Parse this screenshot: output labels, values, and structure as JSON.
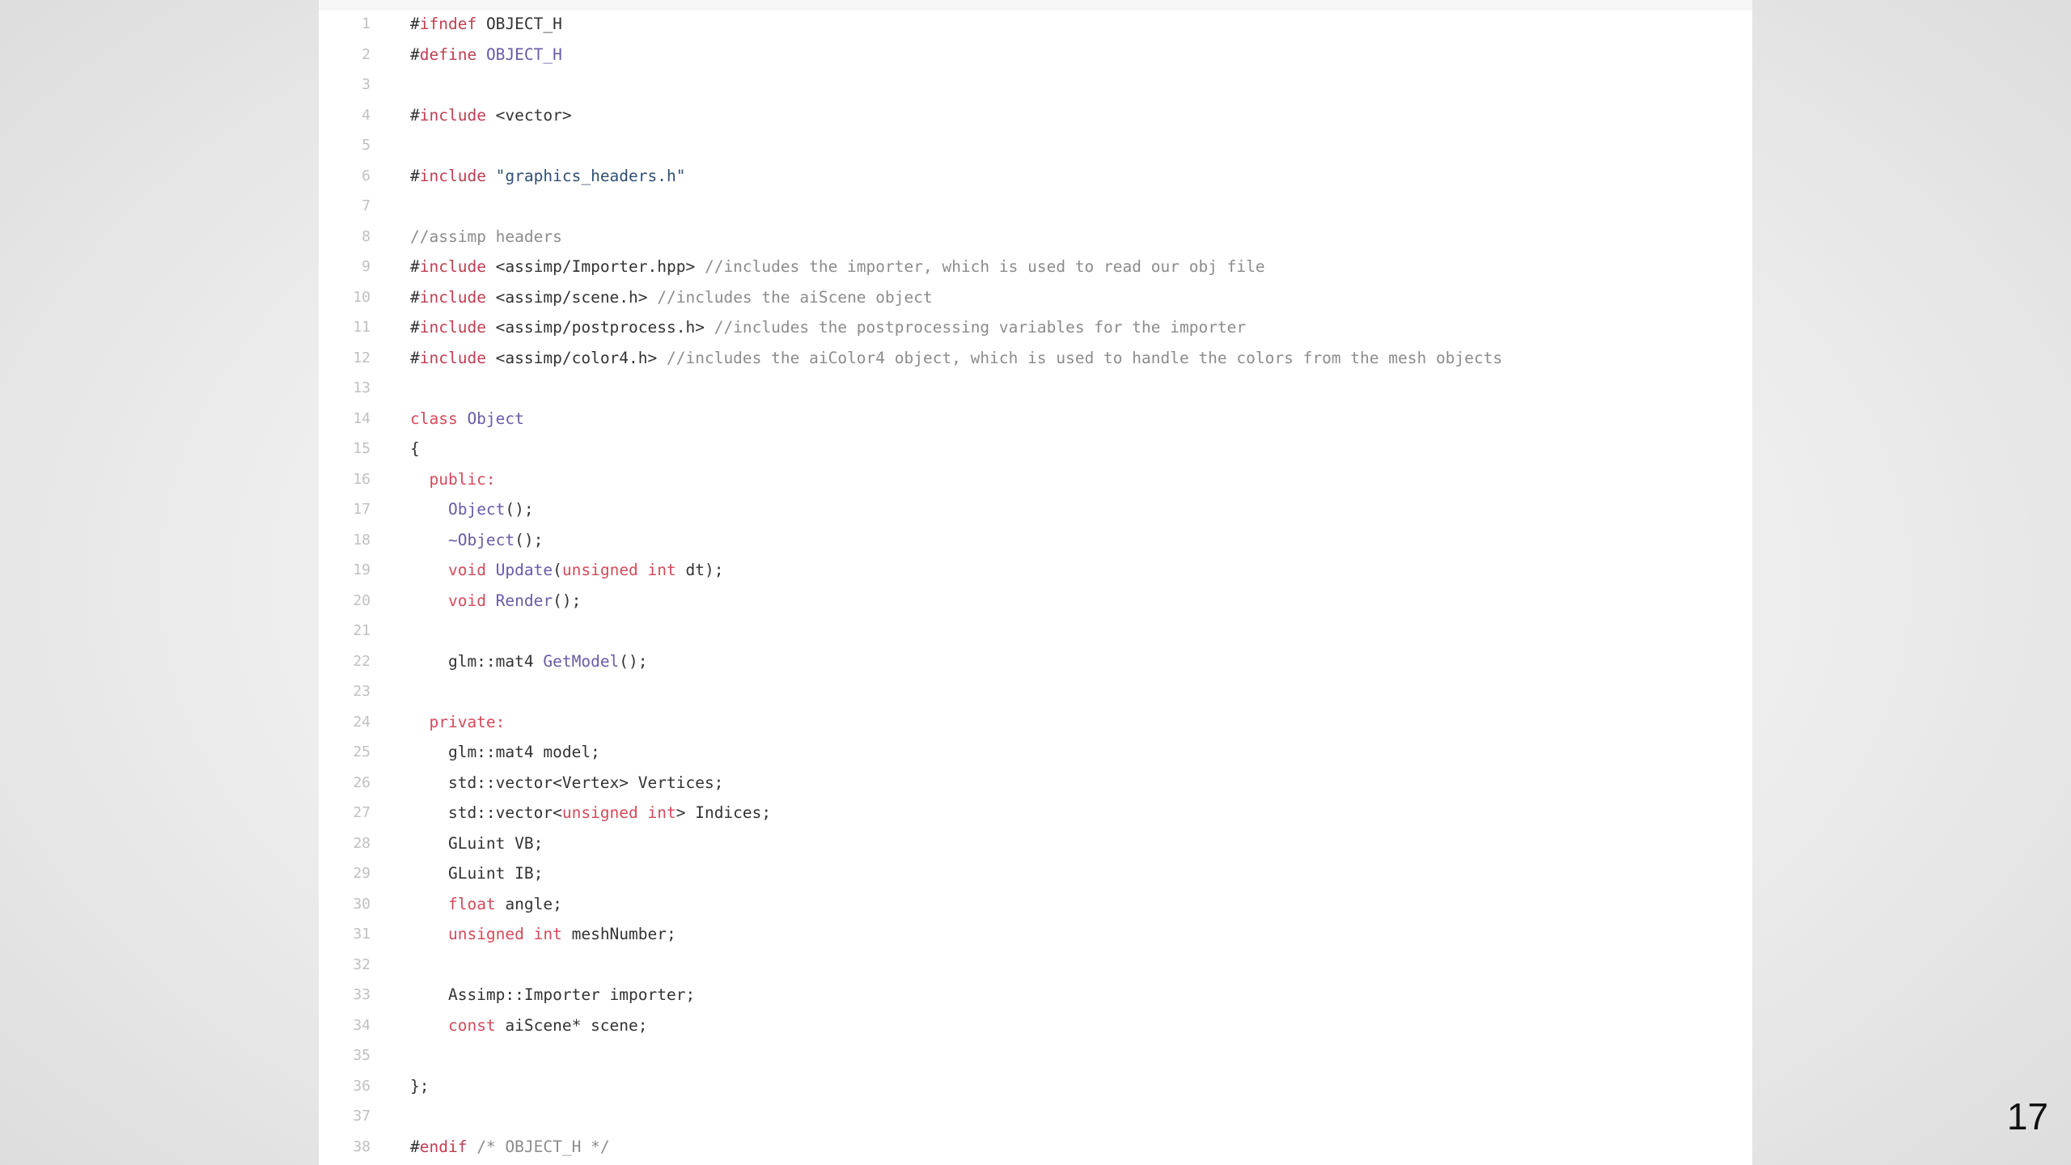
{
  "slide": {
    "number": "17"
  },
  "colors": {
    "keyword": "#d44a5a",
    "preprocessor": "#bf3f52",
    "name": "#6b5aa8",
    "string": "#2f4f74",
    "comment": "#8c8c8c",
    "plain": "#333333",
    "line_number": "#c0c0c0"
  },
  "code": {
    "lines": [
      {
        "num": "1",
        "tokens": [
          [
            "plain",
            "#"
          ],
          [
            "pre",
            "ifndef"
          ],
          [
            "plain",
            " OBJECT_H"
          ]
        ]
      },
      {
        "num": "2",
        "tokens": [
          [
            "plain",
            "#"
          ],
          [
            "pre",
            "define"
          ],
          [
            "name",
            " OBJECT_H"
          ]
        ]
      },
      {
        "num": "3",
        "tokens": []
      },
      {
        "num": "4",
        "tokens": [
          [
            "plain",
            "#"
          ],
          [
            "pre",
            "include"
          ],
          [
            "plain",
            " <vector>"
          ]
        ]
      },
      {
        "num": "5",
        "tokens": []
      },
      {
        "num": "6",
        "tokens": [
          [
            "plain",
            "#"
          ],
          [
            "pre",
            "include"
          ],
          [
            "str",
            " \"graphics_headers.h\""
          ]
        ]
      },
      {
        "num": "7",
        "tokens": []
      },
      {
        "num": "8",
        "tokens": [
          [
            "com",
            "//assimp headers"
          ]
        ]
      },
      {
        "num": "9",
        "tokens": [
          [
            "plain",
            "#"
          ],
          [
            "pre",
            "include"
          ],
          [
            "plain",
            " <assimp/Importer.hpp>"
          ],
          [
            "com",
            " //includes the importer, which is used to read our obj file"
          ]
        ]
      },
      {
        "num": "10",
        "tokens": [
          [
            "plain",
            "#"
          ],
          [
            "pre",
            "include"
          ],
          [
            "plain",
            " <assimp/scene.h>"
          ],
          [
            "com",
            " //includes the aiScene object"
          ]
        ]
      },
      {
        "num": "11",
        "tokens": [
          [
            "plain",
            "#"
          ],
          [
            "pre",
            "include"
          ],
          [
            "plain",
            " <assimp/postprocess.h>"
          ],
          [
            "com",
            " //includes the postprocessing variables for the importer"
          ]
        ]
      },
      {
        "num": "12",
        "tokens": [
          [
            "plain",
            "#"
          ],
          [
            "pre",
            "include"
          ],
          [
            "plain",
            " <assimp/color4.h>"
          ],
          [
            "com",
            " //includes the aiColor4 object, which is used to handle the colors from the mesh objects"
          ]
        ]
      },
      {
        "num": "13",
        "tokens": []
      },
      {
        "num": "14",
        "tokens": [
          [
            "kw",
            "class"
          ],
          [
            "name",
            " Object"
          ]
        ]
      },
      {
        "num": "15",
        "tokens": [
          [
            "plain",
            "{"
          ]
        ]
      },
      {
        "num": "16",
        "tokens": [
          [
            "plain",
            "  "
          ],
          [
            "kw",
            "public:"
          ]
        ]
      },
      {
        "num": "17",
        "tokens": [
          [
            "plain",
            "    "
          ],
          [
            "name",
            "Object"
          ],
          [
            "plain",
            "();"
          ]
        ]
      },
      {
        "num": "18",
        "tokens": [
          [
            "plain",
            "    "
          ],
          [
            "name",
            "~Object"
          ],
          [
            "plain",
            "();"
          ]
        ]
      },
      {
        "num": "19",
        "tokens": [
          [
            "plain",
            "    "
          ],
          [
            "kw",
            "void"
          ],
          [
            "name",
            " Update"
          ],
          [
            "plain",
            "("
          ],
          [
            "kw",
            "unsigned int"
          ],
          [
            "plain",
            " dt);"
          ]
        ]
      },
      {
        "num": "20",
        "tokens": [
          [
            "plain",
            "    "
          ],
          [
            "kw",
            "void"
          ],
          [
            "name",
            " Render"
          ],
          [
            "plain",
            "();"
          ]
        ]
      },
      {
        "num": "21",
        "tokens": []
      },
      {
        "num": "22",
        "tokens": [
          [
            "plain",
            "    glm::mat4 "
          ],
          [
            "name",
            "GetModel"
          ],
          [
            "plain",
            "();"
          ]
        ]
      },
      {
        "num": "23",
        "tokens": []
      },
      {
        "num": "24",
        "tokens": [
          [
            "plain",
            "  "
          ],
          [
            "kw",
            "private:"
          ]
        ]
      },
      {
        "num": "25",
        "tokens": [
          [
            "plain",
            "    glm::mat4 model;"
          ]
        ]
      },
      {
        "num": "26",
        "tokens": [
          [
            "plain",
            "    std::vector<Vertex> Vertices;"
          ]
        ]
      },
      {
        "num": "27",
        "tokens": [
          [
            "plain",
            "    std::vector<"
          ],
          [
            "kw",
            "unsigned int"
          ],
          [
            "plain",
            "> Indices;"
          ]
        ]
      },
      {
        "num": "28",
        "tokens": [
          [
            "plain",
            "    GLuint VB;"
          ]
        ]
      },
      {
        "num": "29",
        "tokens": [
          [
            "plain",
            "    GLuint IB;"
          ]
        ]
      },
      {
        "num": "30",
        "tokens": [
          [
            "plain",
            "    "
          ],
          [
            "kw",
            "float"
          ],
          [
            "plain",
            " angle;"
          ]
        ]
      },
      {
        "num": "31",
        "tokens": [
          [
            "plain",
            "    "
          ],
          [
            "kw",
            "unsigned int"
          ],
          [
            "plain",
            " meshNumber;"
          ]
        ]
      },
      {
        "num": "32",
        "tokens": []
      },
      {
        "num": "33",
        "tokens": [
          [
            "plain",
            "    Assimp::Importer importer;"
          ]
        ]
      },
      {
        "num": "34",
        "tokens": [
          [
            "plain",
            "    "
          ],
          [
            "kw",
            "const"
          ],
          [
            "plain",
            " aiScene* scene;"
          ]
        ]
      },
      {
        "num": "35",
        "tokens": []
      },
      {
        "num": "36",
        "tokens": [
          [
            "plain",
            "};"
          ]
        ]
      },
      {
        "num": "37",
        "tokens": []
      },
      {
        "num": "38",
        "tokens": [
          [
            "plain",
            "#"
          ],
          [
            "pre",
            "endif"
          ],
          [
            "com",
            " /* OBJECT_H */"
          ]
        ]
      }
    ]
  }
}
